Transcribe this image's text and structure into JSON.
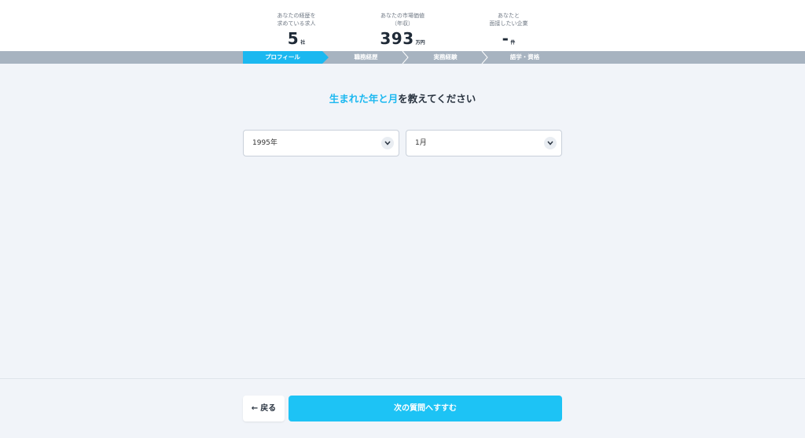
{
  "header": {
    "stats": [
      {
        "label": "あなたの経歴を\n求めている求人",
        "value": "5",
        "unit": "社"
      },
      {
        "label": "あなたの市場価値\n（年収）",
        "value": "393",
        "unit": "万円"
      },
      {
        "label": "あなたと\n面接したい企業",
        "value": "-",
        "unit": "件"
      }
    ]
  },
  "steps": [
    {
      "label": "プロフィール"
    },
    {
      "label": "職務経歴"
    },
    {
      "label": "実務経験"
    },
    {
      "label": "語学・資格"
    }
  ],
  "question": {
    "highlight": "生まれた年と月",
    "rest": "を教えてください"
  },
  "form": {
    "year_value": "1995年",
    "month_value": "1月"
  },
  "footer": {
    "back_label": "戻る",
    "next_label": "次の質問へすすむ"
  },
  "colors": {
    "accent": "#1bb8f0",
    "step_bar": "#a7b3c0",
    "background": "#f1f4f9"
  }
}
